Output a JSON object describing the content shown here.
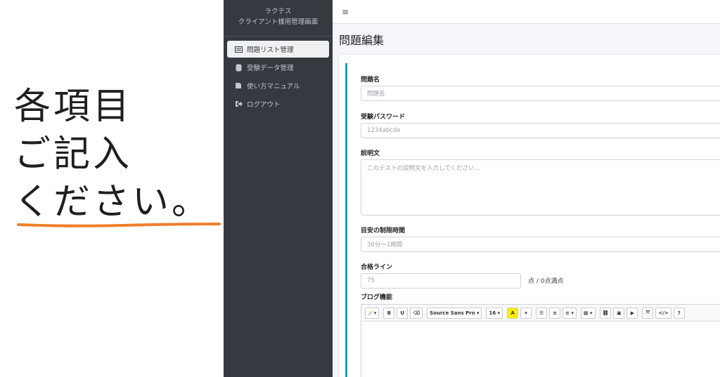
{
  "annotation": {
    "line1": "各項目",
    "line2": "ご記入",
    "line3": "ください。",
    "underline_color": "#f07f2a"
  },
  "sidebar": {
    "brand_line1": "ラクテス",
    "brand_line2": "クライアント様用管理画面",
    "items": [
      {
        "label": "問題リスト管理",
        "icon": "list-icon"
      },
      {
        "label": "受験データ管理",
        "icon": "database-icon"
      },
      {
        "label": "使い方マニュアル",
        "icon": "book-icon"
      },
      {
        "label": "ログアウト",
        "icon": "sign-out-icon"
      }
    ]
  },
  "topbar": {
    "menu_icon": "≡"
  },
  "main": {
    "title": "問題編集",
    "accent_color": "#17a2b8",
    "fields": {
      "name_label": "問題名",
      "name_placeholder": "問題名",
      "password_label": "受験パスワード",
      "password_placeholder": "1234abcde",
      "description_label": "説明文",
      "description_placeholder": "このテストの説明文を入力してください...",
      "time_label": "目安の制限時間",
      "time_placeholder": "30分〜1時間",
      "pass_label": "合格ライン",
      "pass_placeholder": "75",
      "pass_suffix": "点 / 0点満点",
      "blog_label": "ブログ機能"
    },
    "editor_toolbar": {
      "magic": "🪄▾",
      "bold": "B",
      "underline": "U",
      "eraser": "⌫",
      "font": "Source Sans Pro ▾",
      "size": "16 ▾",
      "color": "A",
      "color_dd": "▾",
      "ul": "☰",
      "ol": "≡",
      "align": "≡ ▾",
      "table": "▦ ▾",
      "link": "⛓",
      "picture": "▣",
      "video": "▶",
      "fullscreen": "⤧",
      "code": "</>",
      "help": "?"
    }
  }
}
